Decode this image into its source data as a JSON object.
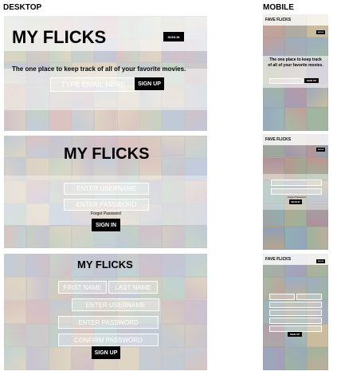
{
  "labels": {
    "desktop": "DESKTOP",
    "mobile": "MOBILE"
  },
  "desktop": {
    "home": {
      "title": "MY FLICKS",
      "signin_label": "SIGN IN",
      "tagline": "The one place to keep track of all of your favorite movies.",
      "email_placeholder": "TYPE EMAIL HERE",
      "signup_label": "SIGN UP"
    },
    "signin": {
      "title": "MY FLICKS",
      "username_placeholder": "ENTER USERNAME",
      "password_placeholder": "ENTER PASSWORD",
      "forgot_label": "Forgot Password",
      "signin_label": "SIGN IN"
    },
    "signup": {
      "title": "MY FLICKS",
      "first_name_placeholder": "FIRST NAME",
      "last_name_placeholder": "LAST NAME",
      "username_placeholder": "ENTER USERNAME",
      "password_placeholder": "ENTER PASSWORD",
      "confirm_placeholder": "CONFIRM PASSWORD",
      "signup_label": "SIGN UP"
    }
  },
  "mobile": {
    "home": {
      "title": "FAVE FLICKS",
      "signin_label": "SIGN IN",
      "tagline": "The one place to keep track of all of your favorite movies.",
      "signup_label": "SIGN UP"
    },
    "signin": {
      "title": "FAVE FLICKS",
      "signin_top_label": "SIGN IN",
      "forgot_label": "Forgot Password",
      "signin_label": "SIGN IN"
    },
    "signup": {
      "title": "FAVE FLICKS",
      "signin_label": "SIGN IN",
      "signup_label": "SIGN UP"
    }
  }
}
